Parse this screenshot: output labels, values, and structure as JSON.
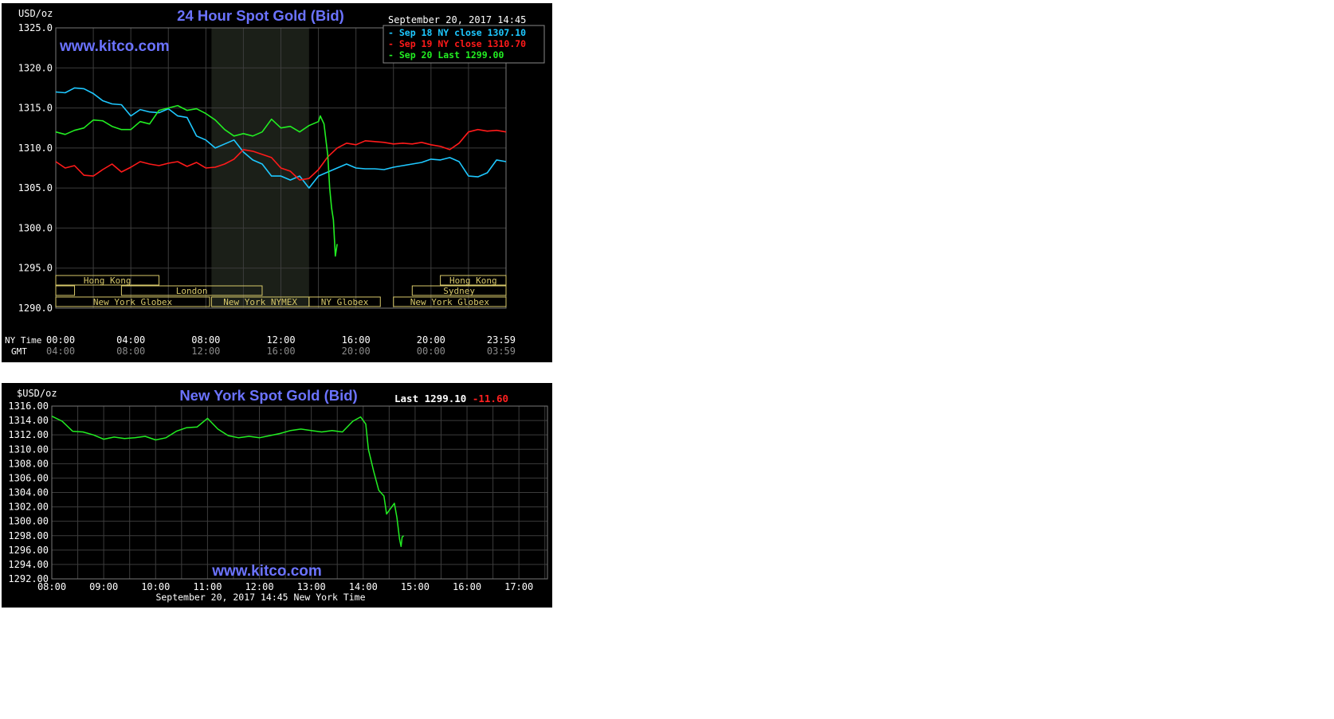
{
  "chart_data": [
    {
      "type": "line",
      "title": "24 Hour Spot Gold (Bid)",
      "website": "www.kitco.com",
      "ylabel": "USD/oz",
      "timestamp": "September 20, 2017 14:45",
      "ylim": [
        1290,
        1325
      ],
      "yticks": [
        "1325.0",
        "1320.0",
        "1315.0",
        "1310.0",
        "1305.0",
        "1300.0",
        "1295.0",
        "1290.0"
      ],
      "x_hours_range": [
        0,
        24
      ],
      "x_row_label_ny": "NY Time",
      "x_row_label_gmt": "GMT",
      "xticks_ny": [
        "00:00",
        "04:00",
        "08:00",
        "12:00",
        "16:00",
        "20:00",
        "23:59"
      ],
      "xticks_gmt": [
        "04:00",
        "08:00",
        "12:00",
        "16:00",
        "20:00",
        "00:00",
        "03:59"
      ],
      "xticks_hours": [
        0,
        4,
        8,
        12,
        16,
        20,
        24
      ],
      "nymex_shade_hours": [
        8.3,
        13.5
      ],
      "legend": [
        "Sep 18 NY close 1307.10",
        "Sep 19 NY close 1310.70",
        "Sep 20 Last 1299.00"
      ],
      "legend_position": "top-right",
      "sessions": [
        {
          "label": "Hong Kong",
          "row": 0,
          "start": 0.0,
          "end": 5.5
        },
        {
          "label": "",
          "row": 1,
          "start": 0.0,
          "end": 1.0
        },
        {
          "label": "London",
          "row": 1,
          "start": 3.5,
          "end": 11.0
        },
        {
          "label": "New York Globex",
          "row": 2,
          "start": 0.0,
          "end": 8.2
        },
        {
          "label": "New York NYMEX",
          "row": 2,
          "start": 8.3,
          "end": 13.5
        },
        {
          "label": "NY Globex",
          "row": 2,
          "start": 13.5,
          "end": 17.3
        },
        {
          "label": "New York Globex",
          "row": 2,
          "start": 18.0,
          "end": 24.0
        },
        {
          "label": "Sydney",
          "row": 1,
          "start": 19.0,
          "end": 24.0
        },
        {
          "label": "Hong Kong",
          "row": 0,
          "start": 20.5,
          "end": 24.0
        }
      ],
      "series": [
        {
          "name": "Sep 18 NY close 1307.10",
          "color": "#1ec8ff",
          "x": [
            0,
            0.5,
            1,
            1.5,
            2,
            2.5,
            3,
            3.5,
            4,
            4.5,
            5,
            5.5,
            6,
            6.5,
            7,
            7.5,
            8,
            8.5,
            9,
            9.5,
            10,
            10.5,
            11,
            11.5,
            12,
            12.5,
            13,
            13.5,
            14,
            14.5,
            15,
            15.5,
            16,
            16.5,
            17,
            17.5,
            18,
            18.5,
            19,
            19.5,
            20,
            20.5,
            21,
            21.5,
            22,
            22.5,
            23,
            23.5,
            24
          ],
          "y": [
            1317.0,
            1316.9,
            1317.5,
            1317.4,
            1316.8,
            1315.9,
            1315.5,
            1315.4,
            1314.0,
            1314.8,
            1314.5,
            1314.4,
            1314.9,
            1314.0,
            1313.8,
            1311.5,
            1311.0,
            1310.0,
            1310.5,
            1311.0,
            1309.5,
            1308.5,
            1308.0,
            1306.5,
            1306.5,
            1306.0,
            1306.5,
            1305.0,
            1306.5,
            1307.0,
            1307.5,
            1308.0,
            1307.5,
            1307.4,
            1307.4,
            1307.3,
            1307.6,
            1307.8,
            1308.0,
            1308.2,
            1308.6,
            1308.5,
            1308.8,
            1308.3,
            1306.5,
            1306.4,
            1306.9,
            1308.5,
            1308.3
          ]
        },
        {
          "name": "Sep 19 NY close 1310.70",
          "color": "#ff1a1a",
          "x": [
            0,
            0.5,
            1,
            1.5,
            2,
            2.5,
            3,
            3.5,
            4,
            4.5,
            5,
            5.5,
            6,
            6.5,
            7,
            7.5,
            8,
            8.5,
            9,
            9.5,
            10,
            10.5,
            11,
            11.5,
            12,
            12.5,
            13,
            13.5,
            14,
            14.5,
            15,
            15.5,
            16,
            16.5,
            17,
            17.5,
            18,
            18.5,
            19,
            19.5,
            20,
            20.5,
            21,
            21.5,
            22,
            22.5,
            23,
            23.5,
            24
          ],
          "y": [
            1308.3,
            1307.5,
            1307.8,
            1306.6,
            1306.5,
            1307.3,
            1308.0,
            1307.0,
            1307.6,
            1308.3,
            1308.0,
            1307.8,
            1308.1,
            1308.3,
            1307.7,
            1308.2,
            1307.5,
            1307.6,
            1308.0,
            1308.6,
            1309.8,
            1309.6,
            1309.2,
            1308.8,
            1307.5,
            1307.1,
            1306.0,
            1306.2,
            1307.3,
            1308.9,
            1310.0,
            1310.6,
            1310.4,
            1310.9,
            1310.8,
            1310.7,
            1310.5,
            1310.6,
            1310.5,
            1310.7,
            1310.4,
            1310.2,
            1309.8,
            1310.6,
            1312.0,
            1312.3,
            1312.1,
            1312.2,
            1312.0
          ]
        },
        {
          "name": "Sep 20 Last 1299.00",
          "color": "#22ee22",
          "x": [
            0,
            0.5,
            1,
            1.5,
            2,
            2.5,
            3,
            3.5,
            4,
            4.5,
            5,
            5.5,
            6,
            6.5,
            7,
            7.5,
            8,
            8.5,
            9,
            9.5,
            10,
            10.5,
            11,
            11.5,
            12,
            12.5,
            13,
            13.5,
            14,
            14.1,
            14.3,
            14.5,
            14.6,
            14.7,
            14.8,
            14.9,
            15.0
          ],
          "y": [
            1312.0,
            1311.7,
            1312.2,
            1312.5,
            1313.5,
            1313.4,
            1312.7,
            1312.3,
            1312.3,
            1313.3,
            1313.0,
            1314.7,
            1315.0,
            1315.3,
            1314.7,
            1314.9,
            1314.3,
            1313.5,
            1312.3,
            1311.5,
            1311.8,
            1311.5,
            1312.0,
            1313.6,
            1312.5,
            1312.7,
            1312.0,
            1312.8,
            1313.3,
            1314.0,
            1313.0,
            1309.0,
            1305.0,
            1302.5,
            1301.0,
            1296.5,
            1298.0
          ]
        }
      ]
    },
    {
      "type": "line",
      "title": "New York Spot Gold (Bid)",
      "website": "www.kitco.com",
      "ylabel": "$USD/oz",
      "last_label": "Last",
      "last_value": "1299.10",
      "change": "-11.60",
      "footer": "September 20, 2017 14:45 New York Time",
      "ylim": [
        1292,
        1316
      ],
      "yticks": [
        "1316.00",
        "1314.00",
        "1312.00",
        "1310.00",
        "1308.00",
        "1306.00",
        "1304.00",
        "1302.00",
        "1300.00",
        "1298.00",
        "1296.00",
        "1294.00",
        "1292.00"
      ],
      "xticks": [
        "08:00",
        "09:00",
        "10:00",
        "11:00",
        "12:00",
        "13:00",
        "14:00",
        "15:00",
        "16:00",
        "17:00"
      ],
      "xticks_hours": [
        8,
        9,
        10,
        11,
        12,
        13,
        14,
        15,
        16,
        17
      ],
      "x_hours_range": [
        8,
        17.55
      ],
      "series": [
        {
          "color": "#22ee22",
          "x": [
            8.0,
            8.2,
            8.4,
            8.6,
            8.8,
            9.0,
            9.2,
            9.4,
            9.6,
            9.8,
            10.0,
            10.2,
            10.4,
            10.6,
            10.8,
            11.0,
            11.2,
            11.4,
            11.6,
            11.8,
            12.0,
            12.2,
            12.4,
            12.6,
            12.8,
            13.0,
            13.2,
            13.4,
            13.6,
            13.8,
            13.95,
            14.05,
            14.1,
            14.2,
            14.3,
            14.4,
            14.45,
            14.55,
            14.6,
            14.65,
            14.7,
            14.73,
            14.75,
            14.78
          ],
          "y": [
            1314.6,
            1313.9,
            1312.5,
            1312.4,
            1312.0,
            1311.4,
            1311.7,
            1311.5,
            1311.6,
            1311.8,
            1311.3,
            1311.6,
            1312.5,
            1313.0,
            1313.1,
            1314.3,
            1312.8,
            1311.9,
            1311.6,
            1311.8,
            1311.6,
            1311.9,
            1312.2,
            1312.6,
            1312.8,
            1312.6,
            1312.4,
            1312.6,
            1312.4,
            1313.9,
            1314.5,
            1313.5,
            1310.0,
            1307.0,
            1304.3,
            1303.5,
            1301.0,
            1302.0,
            1302.5,
            1300.5,
            1297.5,
            1296.5,
            1297.8,
            1298.0
          ]
        }
      ]
    }
  ]
}
